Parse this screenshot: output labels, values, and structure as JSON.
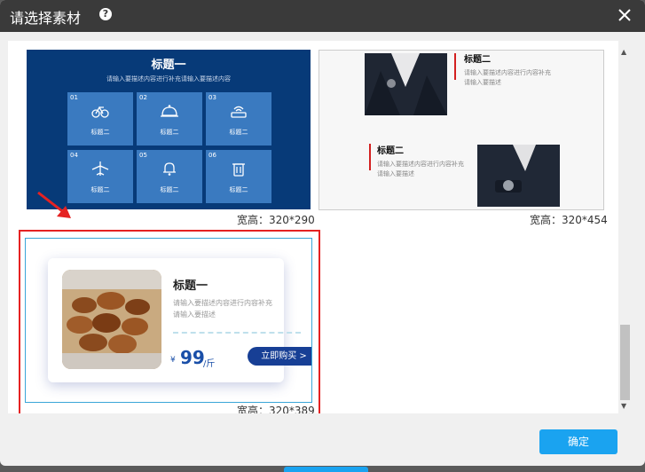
{
  "dialog": {
    "title": "请选择素材",
    "help_glyph": "?",
    "confirm_label": "确定"
  },
  "tiles": [
    {
      "size_label": "宽高：320*290",
      "title": "标题一",
      "subtitle": "请输入要描述内容进行补充请输入要描述内容",
      "cells": [
        {
          "num": "01",
          "icon": "bicycle-icon",
          "text": "标题二"
        },
        {
          "num": "02",
          "icon": "cloche-icon",
          "text": "标题二"
        },
        {
          "num": "03",
          "icon": "router-icon",
          "text": "标题二"
        },
        {
          "num": "04",
          "icon": "airplane-icon",
          "text": "标题二"
        },
        {
          "num": "05",
          "icon": "bell-icon",
          "text": "标题二"
        },
        {
          "num": "06",
          "icon": "trash-icon",
          "text": "标题二"
        }
      ]
    },
    {
      "size_label": "宽高：320*454",
      "blocks": [
        {
          "heading": "标题二",
          "text1": "请输入要描述内容进行内容补充",
          "text2": "请输入要描述"
        },
        {
          "heading": "标题二",
          "text1": "请输入要描述内容进行内容补充",
          "text2": "请输入要描述"
        }
      ]
    },
    {
      "size_label": "宽高：320*389",
      "title": "标题一",
      "desc1": "请输入要描述内容进行内容补充",
      "desc2": "请输入要描述",
      "currency": "¥",
      "price": "99",
      "unit": "/斤",
      "buy_label": "立即购买 >"
    }
  ],
  "colors": {
    "titlebar": "#3a3a3a",
    "confirm": "#1aa3f0",
    "selection": "#e52222",
    "tile_blue": "#073a78",
    "cell_blue": "#3a7ac0",
    "buy_button": "#173f95"
  }
}
